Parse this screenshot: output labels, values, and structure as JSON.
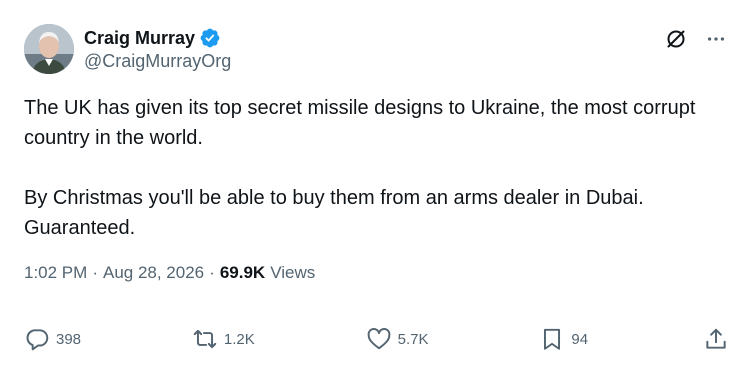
{
  "author": {
    "display_name": "Craig Murray",
    "handle": "@CraigMurrayOrg",
    "verified": true
  },
  "tweet": {
    "paragraphs": [
      "The UK has given its top secret missile designs to Ukraine, the most corrupt country in the world.",
      "By Christmas you'll be able to buy them from an arms dealer in Dubai. Guaranteed."
    ],
    "time": "1:02 PM",
    "separator": "·",
    "date": "Aug 28, 2026",
    "views_count": "69.9K",
    "views_label": "Views"
  },
  "actions": {
    "replies": "398",
    "reposts": "1.2K",
    "likes": "5.7K",
    "bookmarks": "94"
  },
  "icons": {
    "verified": "verified-badge-icon",
    "grok": "grok-icon",
    "more": "more-icon",
    "reply": "reply-icon",
    "repost": "repost-icon",
    "like": "heart-icon",
    "bookmark": "bookmark-icon",
    "share": "share-icon"
  },
  "colors": {
    "text_primary": "#0f1419",
    "text_secondary": "#536471",
    "verified_blue": "#1d9bf0"
  }
}
